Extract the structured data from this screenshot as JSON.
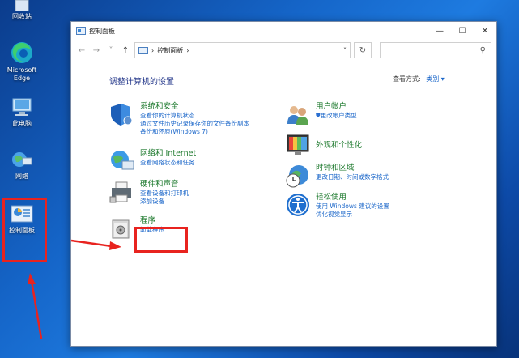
{
  "desktop": {
    "icons": [
      {
        "label": "回收站"
      },
      {
        "label": "Microsoft Edge"
      },
      {
        "label": "此电脑"
      },
      {
        "label": "网络"
      },
      {
        "label": "控制面板"
      }
    ]
  },
  "window": {
    "title": "控制面板",
    "address": "控制面板",
    "address_sep": "›",
    "controls": {
      "minimize": "—",
      "maximize": "☐",
      "close": "✕"
    }
  },
  "content": {
    "heading": "调整计算机的设置",
    "view_by_label": "查看方式:",
    "view_by_value": "类别 ▾",
    "categories": [
      {
        "title": "系统和安全",
        "links": [
          "查看你的计算机状态",
          "通过文件历史记录保存你的文件备份副本",
          "备份和还原(Windows 7)"
        ]
      },
      {
        "title": "网络和 Internet",
        "links": [
          "查看网络状态和任务"
        ]
      },
      {
        "title": "硬件和声音",
        "links": [
          "查看设备和打印机",
          "添加设备"
        ]
      },
      {
        "title": "程序",
        "links": [
          "卸载程序"
        ]
      },
      {
        "title": "用户帐户",
        "links": [
          "更改帐户类型"
        ]
      },
      {
        "title": "外观和个性化",
        "links": []
      },
      {
        "title": "时钟和区域",
        "links": [
          "更改日期、时间或数字格式"
        ]
      },
      {
        "title": "轻松使用",
        "links": [
          "使用 Windows 建议的设置",
          "优化视觉显示"
        ]
      }
    ]
  },
  "colors": {
    "category_title": "#1e7a2e",
    "link": "#1a66c9",
    "heading": "#1e3287",
    "annotation": "#e8231f"
  }
}
